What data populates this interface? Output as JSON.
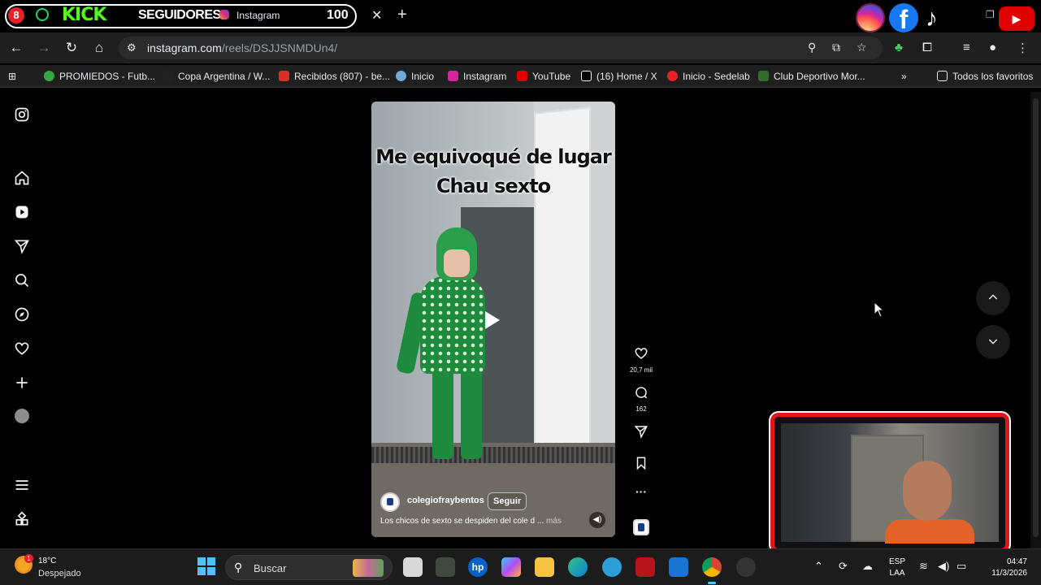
{
  "tabstrip": {
    "badge": "8",
    "kick_text": "KICK",
    "seguidores_text": "SEGUIDORES",
    "tab_title": "Instagram",
    "counter_text": "100",
    "close": "✕",
    "new_tab": "+"
  },
  "navbar": {
    "url_host": "instagram.com",
    "url_path": "/reels/DSJJSNMDUn4/"
  },
  "bookmarks": [
    {
      "label": "PROMIEDOS - Futb...",
      "color": "#3aa546"
    },
    {
      "label": "Copa Argentina / W...",
      "color": "#222"
    },
    {
      "label": "Recibidos (807) - be...",
      "color": "#d93025"
    },
    {
      "label": "Inicio",
      "color": "#6fa8dc"
    },
    {
      "label": "Instagram",
      "color": "#d6249f"
    },
    {
      "label": "YouTube",
      "color": "#e00000"
    },
    {
      "label": "(16) Home / X",
      "color": "#000"
    },
    {
      "label": "Inicio - Sedelab",
      "color": "#e8202a"
    },
    {
      "label": "Club Deportivo Mor...",
      "color": "#2f6e2a"
    }
  ],
  "bookmarks_more": "»",
  "bookmarks_all": "Todos los favoritos",
  "reel": {
    "caption_line1": "Me equivoqué de lugar",
    "caption_line2": "Chau sexto",
    "username": "colegiofraybentos",
    "follow_label": "Seguir",
    "description": "Los chicos de sexto se despiden del cole d ...",
    "more_label": "más"
  },
  "actions": {
    "likes": "20,7 mil",
    "comments": "162",
    "more": "···"
  },
  "taskbar": {
    "temp": "18°C",
    "weather": "Despejado",
    "weather_badge": "1",
    "search_label": "Buscar",
    "lang_top": "ESP",
    "lang_bottom": "LAA",
    "time": "04:47",
    "date": "11/3/2026"
  },
  "colors": {
    "accent": "#4cc2ff",
    "webcam_frame": "#e0151d",
    "kick_green": "#53fc18"
  }
}
